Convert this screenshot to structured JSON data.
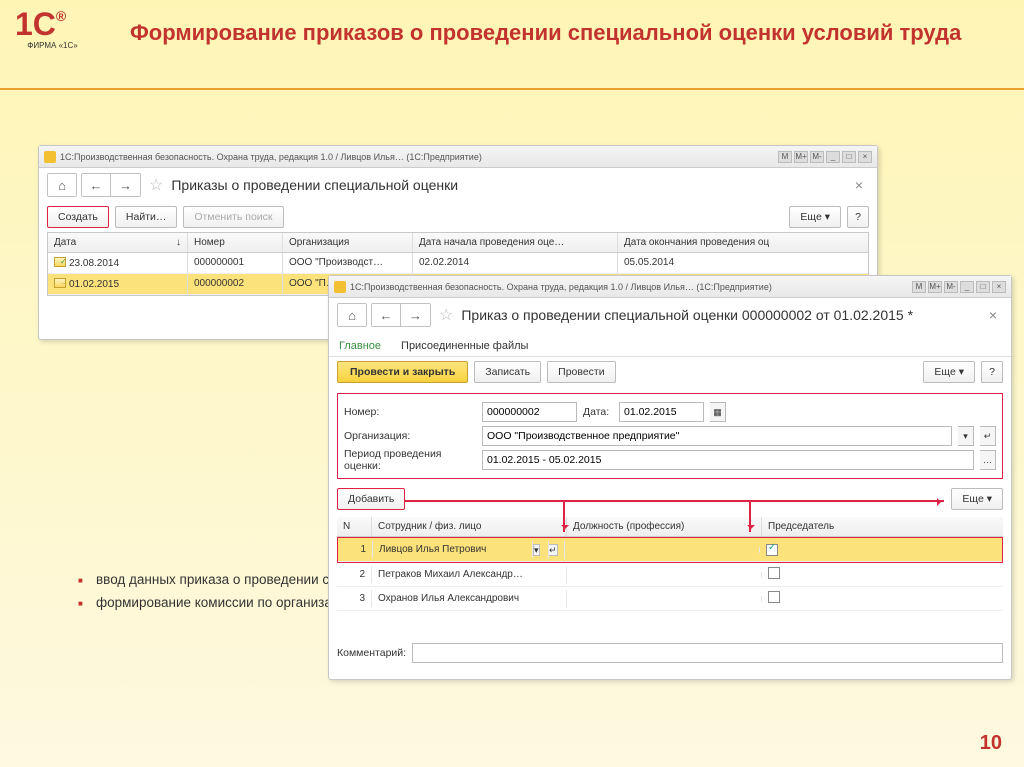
{
  "header": {
    "logo_text": "ФИРМА «1С»",
    "title": "Формирование приказов о проведении специальной оценки условий труда"
  },
  "win1": {
    "titlebar": "1С:Производственная безопасность. Охрана труда, редакция 1.0 / Ливцов Илья…   (1С:Предприятие)",
    "heading": "Приказы о проведении специальной оценки",
    "btn_create": "Создать",
    "btn_find": "Найти…",
    "btn_cancel_find": "Отменить поиск",
    "btn_more": "Еще",
    "btn_help": "?",
    "cols": {
      "date": "Дата",
      "arrow": "↓",
      "num": "Номер",
      "org": "Организация",
      "start": "Дата начала проведения оце…",
      "end": "Дата окончания проведения оц"
    },
    "rows": [
      {
        "date": "23.08.2014",
        "num": "000000001",
        "org": "ООО \"Производст…",
        "start": "02.02.2014",
        "end": "05.05.2014"
      },
      {
        "date": "01.02.2015",
        "num": "000000002",
        "org": "ООО \"П…",
        "start": "",
        "end": ""
      }
    ]
  },
  "win2": {
    "titlebar": "1С:Производственная безопасность. Охрана труда, редакция 1.0 / Ливцов Илья…   (1С:Предприятие)",
    "heading": "Приказ о проведении специальной оценки 000000002 от 01.02.2015 *",
    "tab_main": "Главное",
    "tab_files": "Присоединенные файлы",
    "btn_post_close": "Провести и закрыть",
    "btn_write": "Записать",
    "btn_post": "Провести",
    "btn_more": "Еще",
    "btn_help": "?",
    "fields": {
      "num_label": "Номер:",
      "num": "000000002",
      "date_label": "Дата:",
      "date": "01.02.2015",
      "org_label": "Организация:",
      "org": "ООО \"Производственное предприятие\"",
      "period_label": "Период проведения оценки:",
      "period": "01.02.2015 - 05.02.2015"
    },
    "btn_add": "Добавить",
    "emp_cols": {
      "n": "N",
      "emp": "Сотрудник / физ. лицо",
      "pos": "Должность (профессия)",
      "chair": "Председатель"
    },
    "emps": [
      {
        "n": "1",
        "name": "Ливцов Илья Петрович",
        "pos": "",
        "chair": true
      },
      {
        "n": "2",
        "name": "Петраков Михаил Александр…",
        "pos": "",
        "chair": false
      },
      {
        "n": "3",
        "name": "Охранов Илья Александрович",
        "pos": "",
        "chair": false
      }
    ],
    "comment_label": "Комментарий:"
  },
  "bullets": [
    "ввод данных приказа о проведении специальной оценки условий труда",
    "формирование комиссии по организации и проведению специальной оценки условий труда"
  ],
  "pageno": "10",
  "tb_btns": {
    "min": "_",
    "max": "□",
    "close": "×",
    "m": "M",
    "mp": "M+",
    "mm": "M-"
  }
}
